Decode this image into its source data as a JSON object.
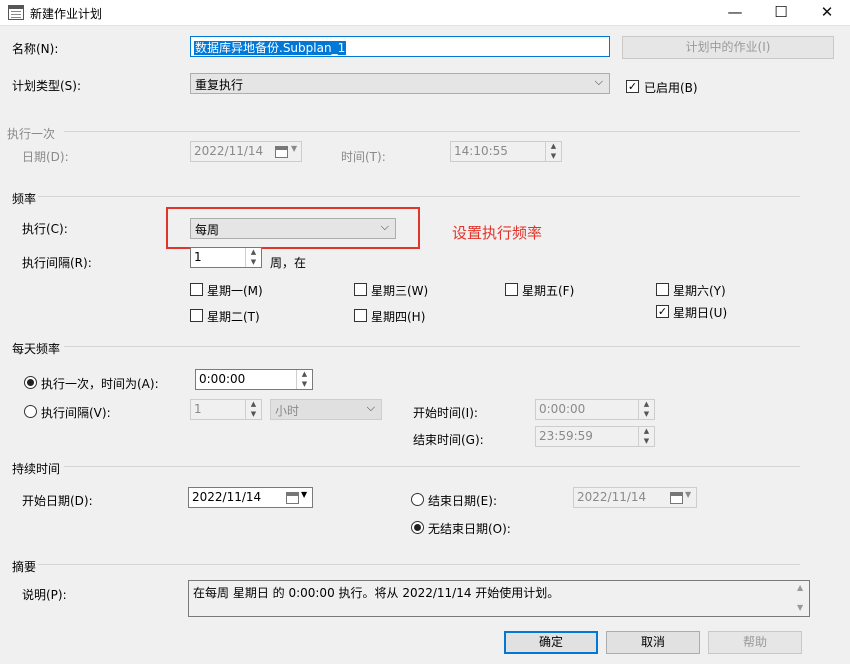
{
  "window": {
    "title": "新建作业计划",
    "min": "—",
    "max": "☐",
    "close": "✕"
  },
  "name": {
    "label": "名称(N):",
    "value": "数据库异地备份.Subplan_1"
  },
  "jobs_in_schedule_button": "计划中的作业(I)",
  "schedule_type": {
    "label": "计划类型(S):",
    "value": "重复执行"
  },
  "enabled": {
    "label": "已启用(B)",
    "checked": true
  },
  "one_time": {
    "section": "执行一次",
    "date_label": "日期(D):",
    "date_value": "2022/11/14",
    "time_label": "时间(T):",
    "time_value": "14:10:55"
  },
  "frequency": {
    "section": "频率",
    "occurs_label": "执行(C):",
    "occurs_value": "每周",
    "annotation": "设置执行频率",
    "recur_label": "执行间隔(R):",
    "recur_value": "1",
    "recur_suffix": "周，在",
    "days": [
      {
        "label": "星期一(M)",
        "checked": false
      },
      {
        "label": "星期三(W)",
        "checked": false
      },
      {
        "label": "星期五(F)",
        "checked": false
      },
      {
        "label": "星期六(Y)",
        "checked": false
      },
      {
        "label": "星期二(T)",
        "checked": false
      },
      {
        "label": "星期四(H)",
        "checked": false
      },
      {
        "label": "星期日(U)",
        "checked": true
      }
    ]
  },
  "daily": {
    "section": "每天频率",
    "once_label": "执行一次，时间为(A):",
    "once_value": "0:00:00",
    "every_label": "执行间隔(V):",
    "every_value": "1",
    "every_unit": "小时",
    "start_label": "开始时间(I):",
    "start_value": "0:00:00",
    "end_label": "结束时间(G):",
    "end_value": "23:59:59"
  },
  "duration": {
    "section": "持续时间",
    "start_label": "开始日期(D):",
    "start_value": "2022/11/14",
    "end_label": "结束日期(E):",
    "end_value": "2022/11/14",
    "no_end_label": "无结束日期(O):"
  },
  "summary": {
    "section": "摘要",
    "desc_label": "说明(P):",
    "desc_value": "在每周 星期日 的 0:00:00 执行。将从 2022/11/14 开始使用计划。"
  },
  "buttons": {
    "ok": "确定",
    "cancel": "取消",
    "help": "帮助"
  },
  "colors": {
    "annotation": "#e0352b",
    "accent": "#0078d7"
  }
}
